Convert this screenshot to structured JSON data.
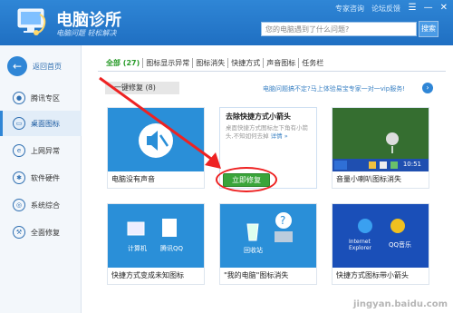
{
  "header": {
    "title": "电脑诊所",
    "subtitle": "电脑问题 轻松解决",
    "links": [
      "专家咨询",
      "论坛反馈"
    ],
    "search_placeholder": "您的电脑遇到了什么问题?",
    "search_button": "搜索"
  },
  "sidebar": {
    "back_label": "返回首页",
    "items": [
      {
        "label": "腾讯专区",
        "icon": "penguin-icon"
      },
      {
        "label": "桌面图标",
        "icon": "desktop-icon"
      },
      {
        "label": "上网异常",
        "icon": "ie-icon"
      },
      {
        "label": "软件硬件",
        "icon": "gear-icon"
      },
      {
        "label": "系统综合",
        "icon": "system-icon"
      },
      {
        "label": "全面修复",
        "icon": "wrench-icon"
      }
    ]
  },
  "tabs": [
    "全部 (27)",
    "图标显示异常",
    "图标消失",
    "快捷方式",
    "声音图标",
    "任务栏"
  ],
  "sub_bar": "一键修复 (8)",
  "promo": "电脑问题搞不定?马上体验易宝专家一对一vip服务!",
  "cards": [
    {
      "caption": "电脑没有声音"
    },
    {
      "title": "去除快捷方式小箭头",
      "desc": "桌面快捷方式图标左下角有小箭头,不知如何去掉",
      "more": "详情 »",
      "fix_button": "立即修复"
    },
    {
      "caption": "音量小喇叭图标消失"
    },
    {
      "caption": "快捷方式变成未知图标"
    },
    {
      "caption": "\"我的电脑\"图标消失"
    },
    {
      "caption": "快捷方式图标带小箭头"
    }
  ],
  "thumb_labels": {
    "card4": [
      "计算机",
      "腾讯QQ"
    ],
    "card5": [
      "回收站"
    ],
    "card6": [
      "Internet Explorer",
      "QQ音乐"
    ],
    "clock": "10:51"
  },
  "watermark": "jingyan.baidu.com",
  "colors": {
    "accent": "#2f86d6",
    "success": "#3aa53a",
    "annotation": "#e22222"
  }
}
